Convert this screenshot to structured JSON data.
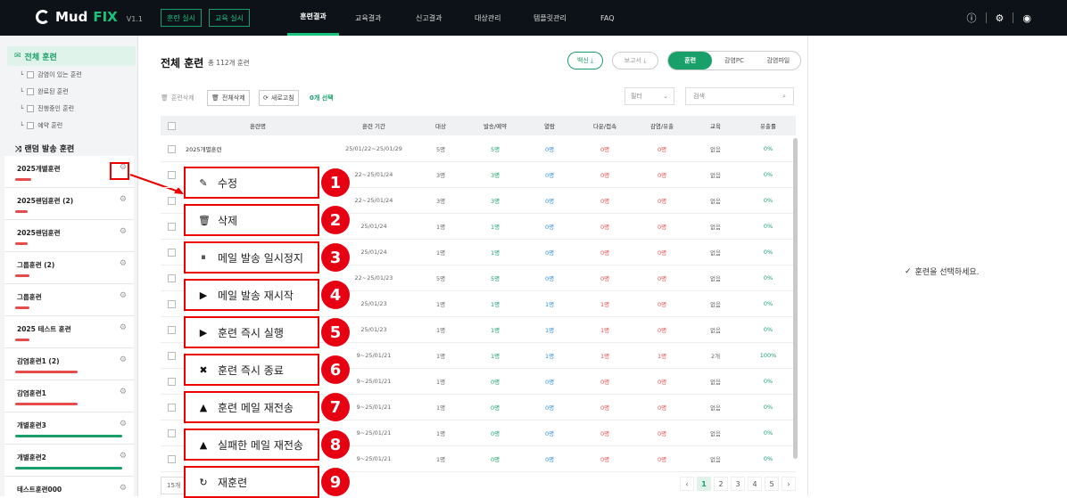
{
  "app": {
    "logo_text": "Mud",
    "logo_fx": "FIX",
    "version": "V1.1"
  },
  "top": {
    "btn1": "훈련 실시",
    "btn2": "교육 실시",
    "nav": [
      "훈련결과",
      "교육결과",
      "신고결과",
      "대상관리",
      "템플릿관리",
      "FAQ"
    ]
  },
  "sidebar": {
    "all": "전체 훈련",
    "subs": [
      "감염이 있는 훈련",
      "완료된 훈련",
      "진행중인 훈련",
      "예약 훈련"
    ],
    "random": "랜덤 발송 훈련",
    "groups": [
      {
        "name": "2025개별훈련",
        "color": "#e64c4c",
        "w": 18
      },
      {
        "name": "2025랜덤훈련 (2)",
        "color": "#e64c4c",
        "w": 14
      },
      {
        "name": "2025랜덤훈련",
        "color": "#e64c4c",
        "w": 14
      },
      {
        "name": "그룹훈련 (2)",
        "color": "#e64c4c",
        "w": 16
      },
      {
        "name": "그룹훈련",
        "color": "#e64c4c",
        "w": 16
      },
      {
        "name": "2025 테스트 훈련",
        "color": "#e64c4c",
        "w": 16
      },
      {
        "name": "감염훈련1 (2)",
        "color": "#e64c4c",
        "w": 70
      },
      {
        "name": "감염훈련1",
        "color": "#e64c4c",
        "w": 70
      },
      {
        "name": "개별훈련3",
        "color": "#19a06a",
        "w": 120
      },
      {
        "name": "개별훈련2",
        "color": "#19a06a",
        "w": 120
      },
      {
        "name": "테스트훈련000",
        "color": "#19a06a",
        "w": 120
      }
    ]
  },
  "main": {
    "title": "전체 훈련",
    "count": "총 112개 훈련",
    "pill1": "백신 ⤓",
    "pill2": "보고서 ⤓",
    "seg": [
      "훈련",
      "감염PC",
      "감염파일"
    ],
    "tools": [
      "훈련삭제",
      "전체삭제",
      "새로고침"
    ],
    "selected": "0개 선택",
    "filter": "필터",
    "search": "검색",
    "headers": [
      "훈련명",
      "훈련 기간",
      "대상",
      "발송/예약",
      "열람",
      "다운/접속",
      "감염/유출",
      "교육",
      "유출률"
    ],
    "rows": [
      [
        "2025개별훈련",
        "25/01/22~25/01/29",
        "5명",
        "5명",
        "0명",
        "0명",
        "0명",
        "없음",
        "0%"
      ],
      [
        "",
        "22~25/01/24",
        "3명",
        "3명",
        "0명",
        "0명",
        "0명",
        "없음",
        "0%"
      ],
      [
        "",
        "22~25/01/24",
        "3명",
        "3명",
        "0명",
        "0명",
        "0명",
        "없음",
        "0%"
      ],
      [
        "",
        "25/01/24",
        "1명",
        "1명",
        "0명",
        "0명",
        "0명",
        "없음",
        "0%"
      ],
      [
        "",
        "25/01/24",
        "1명",
        "1명",
        "0명",
        "0명",
        "0명",
        "없음",
        "0%"
      ],
      [
        "",
        "22~25/01/23",
        "5명",
        "5명",
        "0명",
        "0명",
        "0명",
        "없음",
        "0%"
      ],
      [
        "",
        "25/01/23",
        "1명",
        "1명",
        "1명",
        "1명",
        "0명",
        "없음",
        "0%"
      ],
      [
        "",
        "25/01/23",
        "1명",
        "1명",
        "1명",
        "1명",
        "0명",
        "없음",
        "0%"
      ],
      [
        "",
        "9~25/01/21",
        "1명",
        "1명",
        "1명",
        "1명",
        "1명",
        "2개",
        "100%"
      ],
      [
        "",
        "9~25/01/21",
        "1명",
        "0명",
        "0명",
        "0명",
        "0명",
        "없음",
        "0%"
      ],
      [
        "",
        "9~25/01/21",
        "1명",
        "0명",
        "0명",
        "0명",
        "0명",
        "없음",
        "0%"
      ],
      [
        "",
        "9~25/01/21",
        "1명",
        "0명",
        "0명",
        "0명",
        "0명",
        "없음",
        "0%"
      ],
      [
        "",
        "9~25/01/21",
        "1명",
        "0명",
        "0명",
        "0명",
        "0명",
        "없음",
        "0%"
      ]
    ],
    "perpage": "15개",
    "pages": [
      "1",
      "2",
      "3",
      "4",
      "5"
    ]
  },
  "right": {
    "msg": "훈련을 선택하세요."
  },
  "menu": [
    {
      "label": "수정",
      "icon": "✎",
      "icon_name": "pencil-icon"
    },
    {
      "label": "삭제",
      "icon": "🗑",
      "icon_name": "trash-icon"
    },
    {
      "label": "메일 발송 일시정지",
      "icon": "⏸",
      "icon_name": "pause-icon"
    },
    {
      "label": "메일 발송 재시작",
      "icon": "▶",
      "icon_name": "play-icon"
    },
    {
      "label": "훈련 즉시 실행",
      "icon": "▶",
      "icon_name": "play-icon"
    },
    {
      "label": "훈련 즉시 종료",
      "icon": "✖",
      "icon_name": "stop-icon"
    },
    {
      "label": "훈련 메일 재전송",
      "icon": "▲",
      "icon_name": "warning-icon"
    },
    {
      "label": "실패한 메일 재전송",
      "icon": "▲",
      "icon_name": "warning-icon"
    },
    {
      "label": "재훈련",
      "icon": "↻",
      "icon_name": "retry-icon"
    }
  ]
}
